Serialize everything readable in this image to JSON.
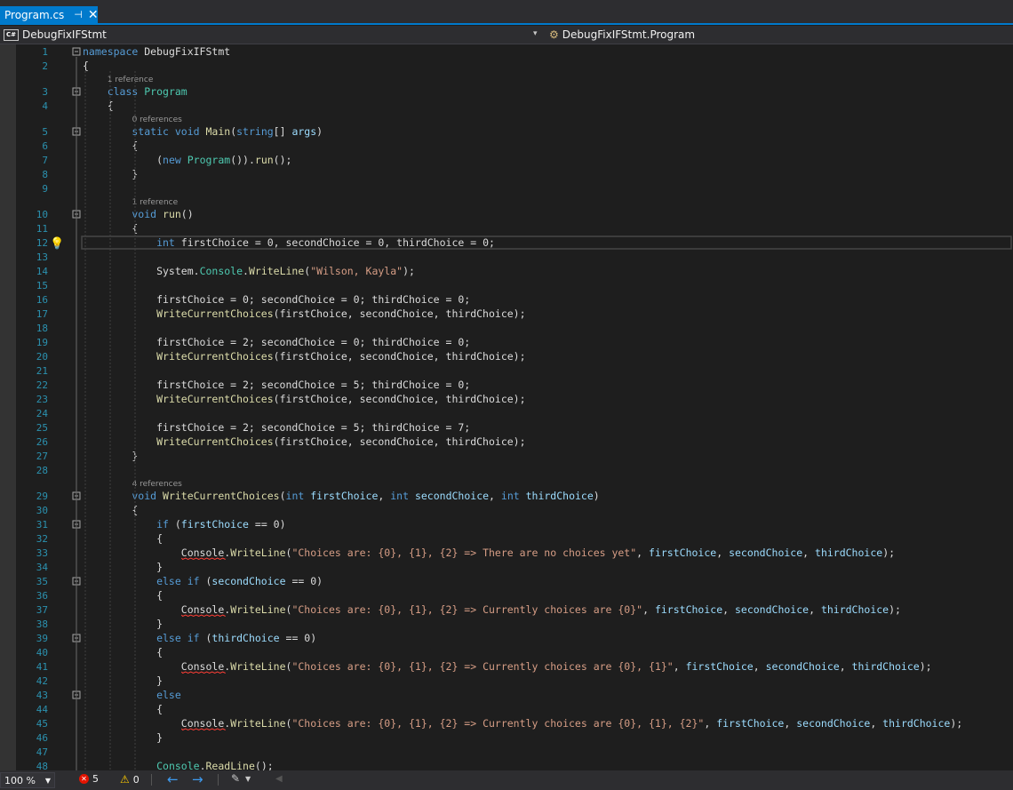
{
  "tab": {
    "title": "Program.cs",
    "pin": "⊣",
    "close": "✕"
  },
  "nav": {
    "project": "DebugFixIFStmt",
    "scope": "DebugFixIFStmt.Program"
  },
  "status": {
    "zoom": "100 %",
    "errors": "5",
    "warnings": "0"
  },
  "colors": {
    "accent": "#007acc",
    "keyword": "#569cd6",
    "type": "#4ec9b0",
    "method": "#dcdcaa",
    "string": "#d69d85",
    "param": "#9cdcfe",
    "text": "#dcdcdc",
    "linenum": "#2b91af"
  },
  "lines": [
    {
      "n": 1,
      "fold": true,
      "t": [
        [
          "namespace ",
          "kw"
        ],
        [
          "DebugFixIFStmt",
          ""
        ]
      ]
    },
    {
      "n": 2,
      "t": [
        [
          "{",
          ""
        ]
      ]
    },
    {
      "lens": "1 reference"
    },
    {
      "n": 3,
      "fold": true,
      "t": [
        [
          "    class ",
          "kw"
        ],
        [
          "Program",
          "ty"
        ]
      ]
    },
    {
      "n": 4,
      "t": [
        [
          "    {",
          ""
        ]
      ]
    },
    {
      "lens": "0 references"
    },
    {
      "n": 5,
      "fold": true,
      "t": [
        [
          "        static ",
          "kw"
        ],
        [
          "void ",
          "kw"
        ],
        [
          "Main",
          "me"
        ],
        [
          "(",
          ""
        ],
        [
          "string",
          "kw"
        ],
        [
          "[] ",
          ""
        ],
        [
          "args",
          "pa"
        ],
        [
          ")",
          ""
        ]
      ]
    },
    {
      "n": 6,
      "t": [
        [
          "        {",
          ""
        ]
      ]
    },
    {
      "n": 7,
      "t": [
        [
          "            (",
          ""
        ],
        [
          "new ",
          "kw"
        ],
        [
          "Program",
          "ty"
        ],
        [
          "()).",
          ""
        ],
        [
          "run",
          "me"
        ],
        [
          "();",
          ""
        ]
      ]
    },
    {
      "n": 8,
      "t": [
        [
          "        }",
          ""
        ]
      ]
    },
    {
      "n": 9,
      "t": []
    },
    {
      "lens": "1 reference"
    },
    {
      "n": 10,
      "fold": true,
      "t": [
        [
          "        void ",
          "kw"
        ],
        [
          "run",
          "me"
        ],
        [
          "()",
          ""
        ]
      ]
    },
    {
      "n": 11,
      "t": [
        [
          "        {",
          ""
        ]
      ]
    },
    {
      "n": 12,
      "current": true,
      "bulb": true,
      "t": [
        [
          "            int ",
          "kw"
        ],
        [
          "firstChoice",
          ""
        ],
        [
          " = 0, ",
          ""
        ],
        [
          "secondChoice",
          ""
        ],
        [
          " = 0, ",
          ""
        ],
        [
          "thirdChoice",
          ""
        ],
        [
          " = 0;",
          ""
        ]
      ]
    },
    {
      "n": 13,
      "t": []
    },
    {
      "n": 14,
      "t": [
        [
          "            System.",
          ""
        ],
        [
          "Console",
          "ty"
        ],
        [
          ".",
          ""
        ],
        [
          "WriteLine",
          "me"
        ],
        [
          "(",
          ""
        ],
        [
          "\"Wilson, Kayla\"",
          "st"
        ],
        [
          ");",
          ""
        ]
      ]
    },
    {
      "n": 15,
      "t": []
    },
    {
      "n": 16,
      "t": [
        [
          "            firstChoice = 0; secondChoice = 0; thirdChoice = 0;",
          ""
        ]
      ]
    },
    {
      "n": 17,
      "t": [
        [
          "            ",
          ""
        ],
        [
          "WriteCurrentChoices",
          "me"
        ],
        [
          "(firstChoice, secondChoice, thirdChoice);",
          ""
        ]
      ]
    },
    {
      "n": 18,
      "t": []
    },
    {
      "n": 19,
      "t": [
        [
          "            firstChoice = 2; secondChoice = 0; thirdChoice = 0;",
          ""
        ]
      ]
    },
    {
      "n": 20,
      "t": [
        [
          "            ",
          ""
        ],
        [
          "WriteCurrentChoices",
          "me"
        ],
        [
          "(firstChoice, secondChoice, thirdChoice);",
          ""
        ]
      ]
    },
    {
      "n": 21,
      "t": []
    },
    {
      "n": 22,
      "t": [
        [
          "            firstChoice = 2; secondChoice = 5; thirdChoice = 0;",
          ""
        ]
      ]
    },
    {
      "n": 23,
      "t": [
        [
          "            ",
          ""
        ],
        [
          "WriteCurrentChoices",
          "me"
        ],
        [
          "(firstChoice, secondChoice, thirdChoice);",
          ""
        ]
      ]
    },
    {
      "n": 24,
      "t": []
    },
    {
      "n": 25,
      "t": [
        [
          "            firstChoice = 2; secondChoice = 5; thirdChoice = 7;",
          ""
        ]
      ]
    },
    {
      "n": 26,
      "t": [
        [
          "            ",
          ""
        ],
        [
          "WriteCurrentChoices",
          "me"
        ],
        [
          "(firstChoice, secondChoice, thirdChoice);",
          ""
        ]
      ]
    },
    {
      "n": 27,
      "t": [
        [
          "        }",
          ""
        ]
      ]
    },
    {
      "n": 28,
      "t": []
    },
    {
      "lens": "4 references"
    },
    {
      "n": 29,
      "fold": true,
      "t": [
        [
          "        void ",
          "kw"
        ],
        [
          "WriteCurrentChoices",
          "me"
        ],
        [
          "(",
          ""
        ],
        [
          "int ",
          "kw"
        ],
        [
          "firstChoice",
          "pa"
        ],
        [
          ", ",
          ""
        ],
        [
          "int ",
          "kw"
        ],
        [
          "secondChoice",
          "pa"
        ],
        [
          ", ",
          ""
        ],
        [
          "int ",
          "kw"
        ],
        [
          "thirdChoice",
          "pa"
        ],
        [
          ")",
          ""
        ]
      ]
    },
    {
      "n": 30,
      "t": [
        [
          "        {",
          ""
        ]
      ]
    },
    {
      "n": 31,
      "fold": true,
      "t": [
        [
          "            if ",
          "kw"
        ],
        [
          "(",
          ""
        ],
        [
          "firstChoice",
          "pa"
        ],
        [
          " == 0)",
          ""
        ]
      ]
    },
    {
      "n": 32,
      "t": [
        [
          "            {",
          ""
        ]
      ]
    },
    {
      "n": 33,
      "t": [
        [
          "                ",
          ""
        ],
        [
          "Console",
          "er"
        ],
        [
          ".",
          ""
        ],
        [
          "WriteLine",
          "me"
        ],
        [
          "(",
          ""
        ],
        [
          "\"Choices are: {0}, {1}, {2} => There are no choices yet\"",
          "st"
        ],
        [
          ", ",
          ""
        ],
        [
          "firstChoice",
          "pa"
        ],
        [
          ", ",
          ""
        ],
        [
          "secondChoice",
          "pa"
        ],
        [
          ", ",
          ""
        ],
        [
          "thirdChoice",
          "pa"
        ],
        [
          ");",
          ""
        ]
      ]
    },
    {
      "n": 34,
      "t": [
        [
          "            }",
          ""
        ]
      ]
    },
    {
      "n": 35,
      "fold": true,
      "t": [
        [
          "            else if ",
          "kw"
        ],
        [
          "(",
          ""
        ],
        [
          "secondChoice",
          "pa"
        ],
        [
          " == 0)",
          ""
        ]
      ]
    },
    {
      "n": 36,
      "t": [
        [
          "            {",
          ""
        ]
      ]
    },
    {
      "n": 37,
      "t": [
        [
          "                ",
          ""
        ],
        [
          "Console",
          "er"
        ],
        [
          ".",
          ""
        ],
        [
          "WriteLine",
          "me"
        ],
        [
          "(",
          ""
        ],
        [
          "\"Choices are: {0}, {1}, {2} => Currently choices are {0}\"",
          "st"
        ],
        [
          ", ",
          ""
        ],
        [
          "firstChoice",
          "pa"
        ],
        [
          ", ",
          ""
        ],
        [
          "secondChoice",
          "pa"
        ],
        [
          ", ",
          ""
        ],
        [
          "thirdChoice",
          "pa"
        ],
        [
          ");",
          ""
        ]
      ]
    },
    {
      "n": 38,
      "t": [
        [
          "            }",
          ""
        ]
      ]
    },
    {
      "n": 39,
      "fold": true,
      "t": [
        [
          "            else if ",
          "kw"
        ],
        [
          "(",
          ""
        ],
        [
          "thirdChoice",
          "pa"
        ],
        [
          " == 0)",
          ""
        ]
      ]
    },
    {
      "n": 40,
      "t": [
        [
          "            {",
          ""
        ]
      ]
    },
    {
      "n": 41,
      "t": [
        [
          "                ",
          ""
        ],
        [
          "Console",
          "er"
        ],
        [
          ".",
          ""
        ],
        [
          "WriteLine",
          "me"
        ],
        [
          "(",
          ""
        ],
        [
          "\"Choices are: {0}, {1}, {2} => Currently choices are {0}, {1}\"",
          "st"
        ],
        [
          ", ",
          ""
        ],
        [
          "firstChoice",
          "pa"
        ],
        [
          ", ",
          ""
        ],
        [
          "secondChoice",
          "pa"
        ],
        [
          ", ",
          ""
        ],
        [
          "thirdChoice",
          "pa"
        ],
        [
          ");",
          ""
        ]
      ]
    },
    {
      "n": 42,
      "t": [
        [
          "            }",
          ""
        ]
      ]
    },
    {
      "n": 43,
      "fold": true,
      "t": [
        [
          "            else",
          "kw"
        ]
      ]
    },
    {
      "n": 44,
      "t": [
        [
          "            {",
          ""
        ]
      ]
    },
    {
      "n": 45,
      "t": [
        [
          "                ",
          ""
        ],
        [
          "Console",
          "er"
        ],
        [
          ".",
          ""
        ],
        [
          "WriteLine",
          "me"
        ],
        [
          "(",
          ""
        ],
        [
          "\"Choices are: {0}, {1}, {2} => Currently choices are {0}, {1}, {2}\"",
          "st"
        ],
        [
          ", ",
          ""
        ],
        [
          "firstChoice",
          "pa"
        ],
        [
          ", ",
          ""
        ],
        [
          "secondChoice",
          "pa"
        ],
        [
          ", ",
          ""
        ],
        [
          "thirdChoice",
          "pa"
        ],
        [
          ");",
          ""
        ]
      ]
    },
    {
      "n": 46,
      "t": [
        [
          "            }",
          ""
        ]
      ]
    },
    {
      "n": 47,
      "t": []
    },
    {
      "n": 48,
      "t": [
        [
          "            ",
          ""
        ],
        [
          "Console",
          "ty"
        ],
        [
          ".",
          ""
        ],
        [
          "ReadLine",
          "me"
        ],
        [
          "();",
          ""
        ]
      ]
    }
  ]
}
